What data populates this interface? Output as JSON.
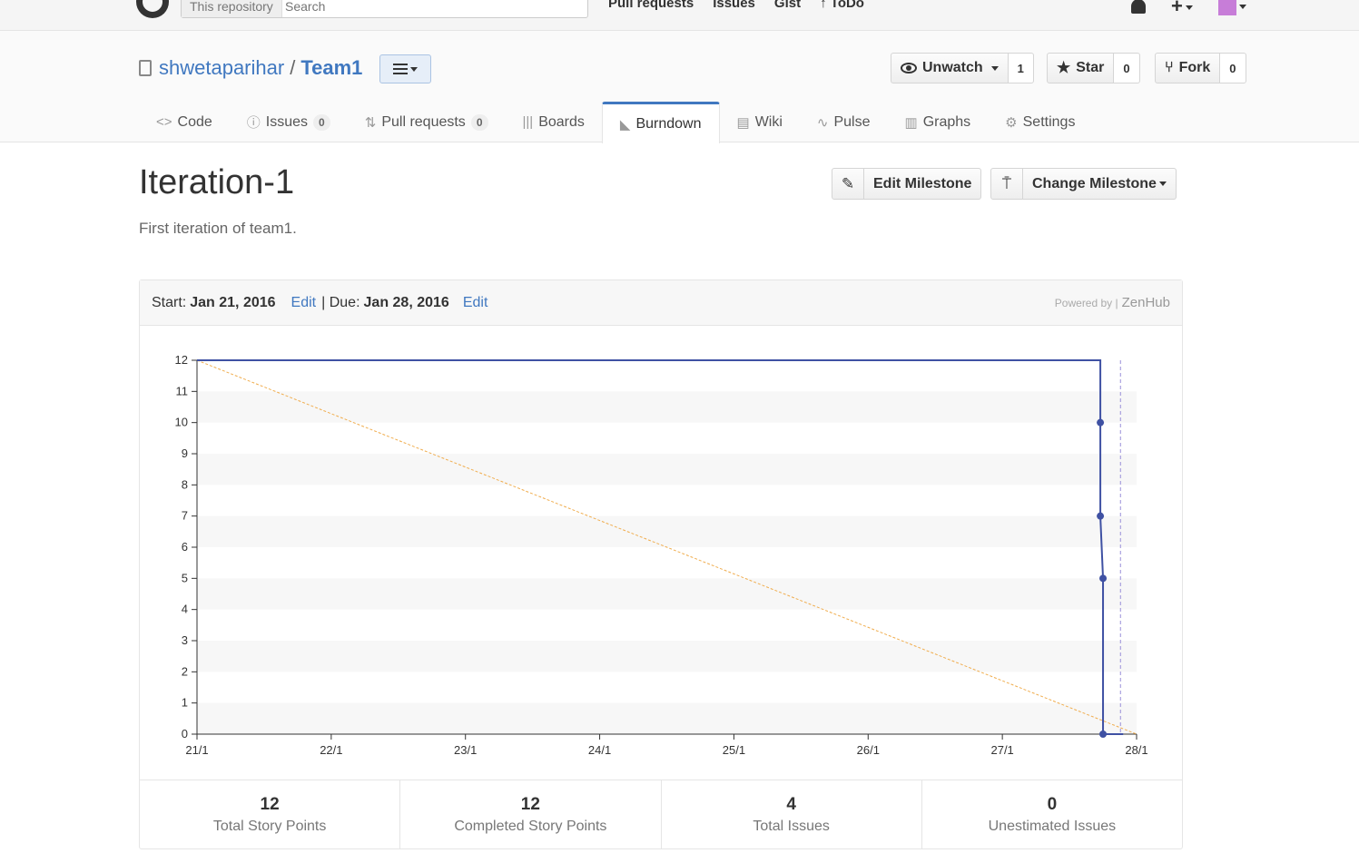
{
  "topbar": {
    "search_scope": "This repository",
    "search_placeholder": "Search",
    "nav": [
      "Pull requests",
      "Issues",
      "Gist",
      "ToDo"
    ]
  },
  "repo": {
    "owner": "shwetaparihar",
    "separator": "/",
    "name": "Team1",
    "unwatch_label": "Unwatch",
    "watch_count": "1",
    "star_label": "Star",
    "star_count": "0",
    "fork_label": "Fork",
    "fork_count": "0"
  },
  "tabs": [
    {
      "label": "Code",
      "icon": "code-icon"
    },
    {
      "label": "Issues",
      "icon": "issue-icon",
      "badge": "0"
    },
    {
      "label": "Pull requests",
      "icon": "pull-request-icon",
      "badge": "0"
    },
    {
      "label": "Boards",
      "icon": "boards-icon"
    },
    {
      "label": "Burndown",
      "icon": "burndown-icon",
      "active": true
    },
    {
      "label": "Wiki",
      "icon": "wiki-icon"
    },
    {
      "label": "Pulse",
      "icon": "pulse-icon"
    },
    {
      "label": "Graphs",
      "icon": "graphs-icon"
    },
    {
      "label": "Settings",
      "icon": "gear-icon"
    }
  ],
  "milestone": {
    "title": "Iteration-1",
    "description": "First iteration of team1.",
    "edit_label": "Edit Milestone",
    "change_label": "Change Milestone"
  },
  "panel": {
    "start_label": "Start:",
    "start_date": "Jan 21, 2016",
    "edit1": "Edit",
    "due_label": "| Due:",
    "due_date": "Jan 28, 2016",
    "edit2": "Edit",
    "powered_by": "Powered by |",
    "brand": "ZenHub"
  },
  "chart_data": {
    "type": "line",
    "x_ticks": [
      "21/1",
      "22/1",
      "23/1",
      "24/1",
      "25/1",
      "26/1",
      "27/1",
      "28/1"
    ],
    "y_ticks": [
      0,
      1,
      2,
      3,
      4,
      5,
      6,
      7,
      8,
      9,
      10,
      11,
      12
    ],
    "ylim": [
      0,
      12
    ],
    "xlim_days": [
      0,
      7
    ],
    "series": [
      {
        "color": "#f0ad4e",
        "style": "dashed",
        "points": [
          [
            0,
            12
          ],
          [
            7,
            0
          ]
        ]
      },
      {
        "color": "#3f51a3",
        "style": "solid",
        "points": [
          [
            0,
            12
          ],
          [
            6.73,
            12
          ],
          [
            6.73,
            10
          ],
          [
            6.73,
            7
          ],
          [
            6.75,
            5
          ],
          [
            6.75,
            0
          ],
          [
            6.9,
            0
          ]
        ],
        "markers": [
          [
            6.73,
            10
          ],
          [
            6.73,
            7
          ],
          [
            6.75,
            5
          ],
          [
            6.75,
            0
          ]
        ]
      }
    ],
    "today_marker_day": 6.88,
    "grid": true
  },
  "stats": [
    {
      "value": "12",
      "label": "Total Story Points"
    },
    {
      "value": "12",
      "label": "Completed Story Points"
    },
    {
      "value": "4",
      "label": "Total Issues"
    },
    {
      "value": "0",
      "label": "Unestimated Issues"
    }
  ]
}
